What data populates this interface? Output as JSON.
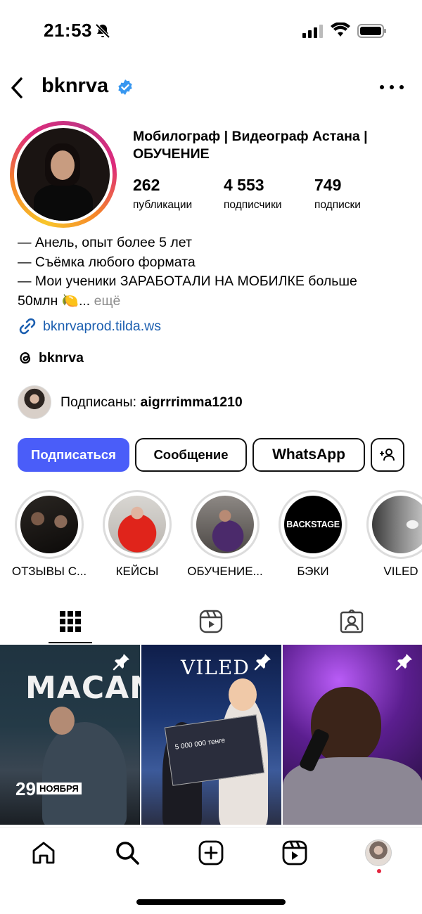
{
  "status_bar": {
    "time": "21:53",
    "icons": [
      "bell-muted-icon",
      "signal-icon",
      "wifi-icon",
      "battery-icon"
    ]
  },
  "header": {
    "username": "bknrva",
    "back_icon": "chevron-left-icon",
    "more_icon": "more-horizontal-icon",
    "verified_icon": "verified-badge-icon"
  },
  "profile": {
    "name": "Мобилограф | Видеограф Астана | ОБУЧЕНИЕ",
    "stats": [
      {
        "value": "262",
        "label": "публикации"
      },
      {
        "value": "4 553",
        "label": "подписчики"
      },
      {
        "value": "749",
        "label": "подписки"
      }
    ],
    "bio_lines": [
      "— Анель, опыт более 5 лет",
      "— Съёмка любого формата",
      "— Мои ученики ЗАРАБОТАЛИ НА МОБИЛКЕ больше",
      "50млн 🍋..."
    ],
    "bio_more": "ещё",
    "link": "bknrvaprod.tilda.ws",
    "threads_handle": "bknrva",
    "followed_by_prefix": "Подписаны: ",
    "followed_by_user": "aigrrrimma1210"
  },
  "actions": {
    "follow": "Подписаться",
    "message": "Сообщение",
    "whatsapp": "WhatsApp",
    "add_user_icon": "add-user-icon"
  },
  "highlights": [
    {
      "label": "ОТЗЫВЫ С..."
    },
    {
      "label": "КЕЙСЫ"
    },
    {
      "label": "ОБУЧЕНИЕ..."
    },
    {
      "label": "БЭКИ",
      "cover_text": "BACKSTAGE"
    },
    {
      "label": "VILED"
    }
  ],
  "tabs": [
    {
      "name": "grid",
      "icon": "grid-icon",
      "active": true
    },
    {
      "name": "reels",
      "icon": "reels-icon",
      "active": false
    },
    {
      "name": "tagged",
      "icon": "tagged-icon",
      "active": false
    }
  ],
  "posts": [
    {
      "title": "MACAN",
      "day": "29",
      "month": "НОЯБРЯ",
      "pinned": true
    },
    {
      "title": "VILED",
      "cheque_amount": "5 000 000 тенге",
      "pinned": true
    },
    {
      "pinned": true
    }
  ],
  "bottom_nav": [
    "home-icon",
    "search-icon",
    "create-icon",
    "reels-icon",
    "profile-avatar"
  ],
  "colors": {
    "follow_button": "#4a5df9",
    "link": "#1c5fb0",
    "verified": "#3897f0",
    "notification_dot": "#e3263f"
  }
}
